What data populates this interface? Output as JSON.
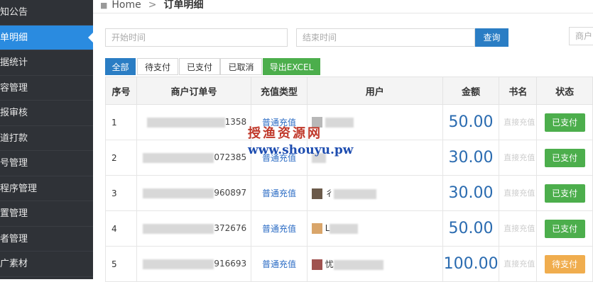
{
  "sidebar": {
    "items": [
      "知公告",
      "单明细",
      "据统计",
      "容管理",
      "报审核",
      "道打款",
      "号管理",
      "程序管理",
      "置管理",
      "者管理",
      "广素材"
    ],
    "active_index": 1
  },
  "breadcrumb": {
    "home": "Home",
    "separator": ">",
    "current": "订单明细"
  },
  "filters": {
    "start_placeholder": "开始时间",
    "end_placeholder": "结束时间",
    "search_label": "查询",
    "merchant_placeholder": "商户"
  },
  "tabs": [
    "全部",
    "待支付",
    "已支付",
    "已取消",
    "导出EXCEL"
  ],
  "table": {
    "headers": [
      "序号",
      "商户订单号",
      "充值类型",
      "用户",
      "金额",
      "书名",
      "状态"
    ],
    "rows": [
      {
        "seq": "1",
        "order": "1358",
        "type": "普通充值",
        "user": "",
        "amount": "50.00",
        "book": "直接充值",
        "status": "已支付"
      },
      {
        "seq": "2",
        "order": "072385",
        "type": "普通充值",
        "user": "",
        "amount": "30.00",
        "book": "直接充值",
        "status": "已支付"
      },
      {
        "seq": "3",
        "order": "960897",
        "type": "普通充值",
        "user": "彳",
        "amount": "30.00",
        "book": "直接充值",
        "status": "已支付"
      },
      {
        "seq": "4",
        "order": "372676",
        "type": "普通充值",
        "user": "L",
        "amount": "50.00",
        "book": "直接充值",
        "status": "已支付"
      },
      {
        "seq": "5",
        "order": "916693",
        "type": "普通充值",
        "user": "忧",
        "amount": "100.00",
        "book": "直接充值",
        "status": "待支付"
      }
    ]
  },
  "watermark": {
    "line1": "授渔资源网",
    "line2": "www.shouyu.pw"
  },
  "colors": {
    "sidebar_bg": "#2f3237",
    "active_blue": "#2a8be0",
    "paid_green": "#4cae4c",
    "pending_orange": "#f0ad4e"
  }
}
